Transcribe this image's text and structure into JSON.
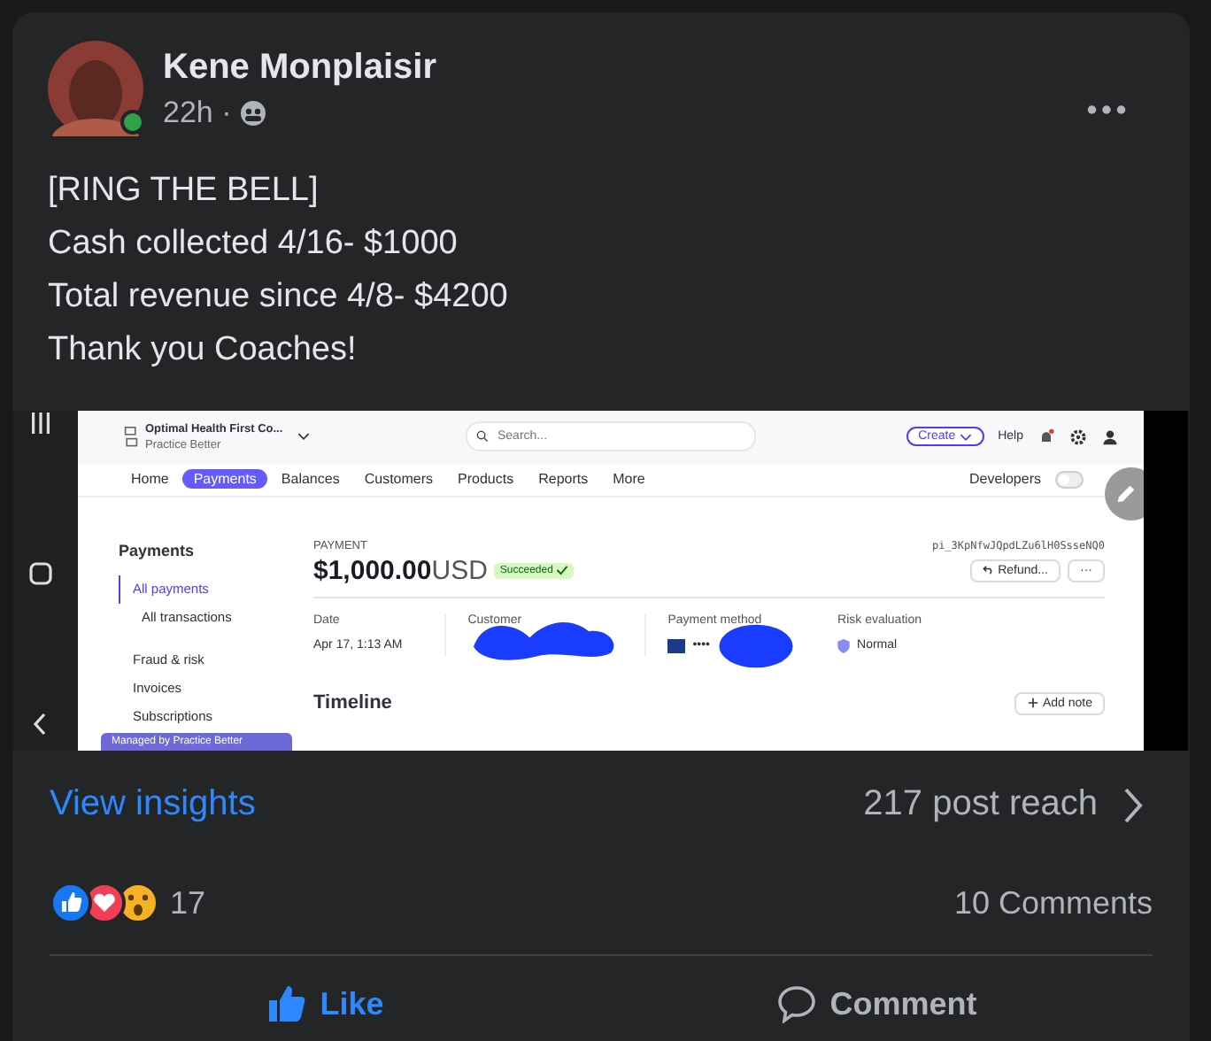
{
  "post": {
    "author": "Kene Monplaisir",
    "online": true,
    "time": "22h ·",
    "text_lines": [
      "[RING THE BELL]",
      "Cash collected 4/16- $1000",
      "Total revenue since 4/8- $4200",
      "Thank you Coaches!"
    ]
  },
  "screenshot": {
    "org_name": "Optimal Health First Co...",
    "org_sub": "Practice Better",
    "search": {
      "placeholder": "Search..."
    },
    "create": "Create",
    "help": "Help",
    "nav": [
      {
        "label": "Home",
        "selected": false
      },
      {
        "label": "Payments",
        "selected": true
      },
      {
        "label": "Balances",
        "selected": false
      },
      {
        "label": "Customers",
        "selected": false
      },
      {
        "label": "Products",
        "selected": false
      },
      {
        "label": "Reports",
        "selected": false
      },
      {
        "label": "More",
        "selected": false
      }
    ],
    "developers": "Developers",
    "test_mode_on": false,
    "sidebar": {
      "title": "Payments",
      "items": [
        {
          "label": "All payments",
          "selected": true,
          "children": [
            {
              "label": "All transactions",
              "selected": false
            }
          ]
        },
        {
          "label": "Fraud & risk",
          "selected": false
        },
        {
          "label": "Invoices",
          "selected": false
        },
        {
          "label": "Subscriptions",
          "selected": false
        }
      ],
      "banner": "Managed by Practice Better"
    },
    "payment": {
      "label": "PAYMENT",
      "amount": "$1,000.00",
      "currency": "USD",
      "status": "Succeeded",
      "id": "pi_3KpNfwJQpdLZu6lH0SsseNQ0",
      "refund": "Refund...",
      "more": "···",
      "details": [
        {
          "kind": "text",
          "label": "Date",
          "value": "Apr 17, 1:13 AM"
        },
        {
          "kind": "redacted",
          "label": "Customer"
        },
        {
          "kind": "card",
          "label": "Payment method",
          "value": "••••"
        },
        {
          "kind": "risk",
          "label": "Risk evaluation",
          "value": "Normal"
        }
      ],
      "timeline": "Timeline",
      "add_note": "Add note"
    }
  },
  "footer": {
    "insights": "View insights",
    "reach": "217 post reach",
    "reaction_count": "17",
    "comments": "10 Comments",
    "actions": [
      {
        "kind": "like",
        "label": "Like"
      },
      {
        "kind": "comment",
        "label": "Comment"
      }
    ]
  }
}
